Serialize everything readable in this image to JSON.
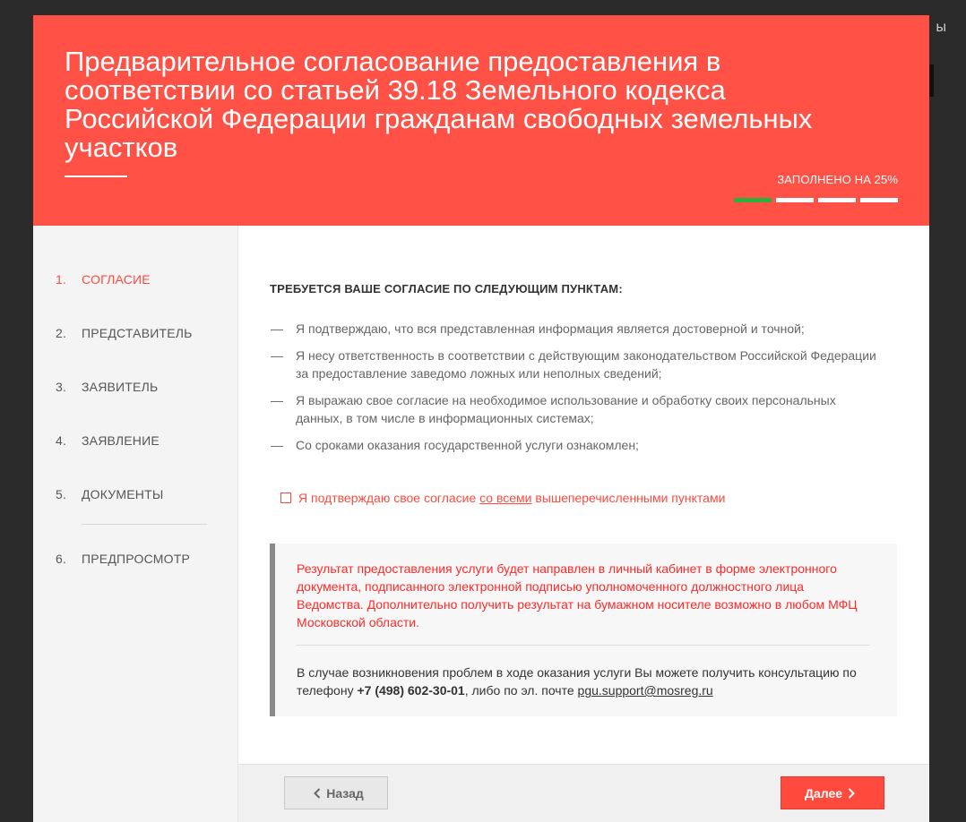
{
  "background": {
    "fragment": "ы"
  },
  "header": {
    "title": "Предварительное согласование предоставления в соответствии со статьей 39.18 Земельного кодекса Российской Федерации гражданам свободных земельных участков",
    "progress_label": "ЗАПОЛНЕНО НА 25%",
    "progress": {
      "completed_segments": 1,
      "total_segments": 4
    }
  },
  "sidebar": {
    "steps": [
      {
        "num": "1.",
        "label": "СОГЛАСИЕ"
      },
      {
        "num": "2.",
        "label": "ПРЕДСТАВИТЕЛЬ"
      },
      {
        "num": "3.",
        "label": "ЗАЯВИТЕЛЬ"
      },
      {
        "num": "4.",
        "label": "ЗАЯВЛЕНИЕ"
      },
      {
        "num": "5.",
        "label": "ДОКУМЕНТЫ"
      },
      {
        "num": "6.",
        "label": "ПРЕДПРОСМОТР"
      }
    ],
    "active_step": 1
  },
  "content": {
    "heading": "ТРЕБУЕТСЯ ВАШЕ СОГЛАСИЕ ПО СЛЕДУЮЩИМ ПУНКТАМ:",
    "dash": "—",
    "items": [
      "Я подтверждаю, что вся представленная информация является достоверной и точной;",
      "Я несу ответственность в соответствии с действующим законодательством Российской Федерации за предоставление заведомо ложных или неполных сведений;",
      "Я выражаю свое согласие на необходимое использование и обработку своих персональных данных, в том числе в информационных системах;",
      "Со сроками оказания государственной услуги ознакомлен;"
    ],
    "agree": {
      "before": "Я подтверждаю свое согласие ",
      "link": "со всеми",
      "after": " вышеперечисленными пунктами"
    },
    "info": {
      "result_text": "Результат предоставления услуги будет направлен в личный кабинет в форме электронного документа, подписанного электронной подписью уполномоченного должностного лица Ведомства. Дополнительно получить результат на бумажном носителе возможно в любом МФЦ Московской области.",
      "help_before": "В случае возникновения проблем в ходе оказания услуги Вы можете получить консультацию по телефону ",
      "phone": "+7 (498) 602-30-01",
      "help_middle": ", либо по эл. почте ",
      "email": "pgu.support@mosreg.ru"
    }
  },
  "footer": {
    "back_label": "Назад",
    "next_label": "Далее"
  },
  "colors": {
    "accent": "#ff5145",
    "progress_done": "#2fae3a",
    "info_red": "#ff2a2a"
  }
}
